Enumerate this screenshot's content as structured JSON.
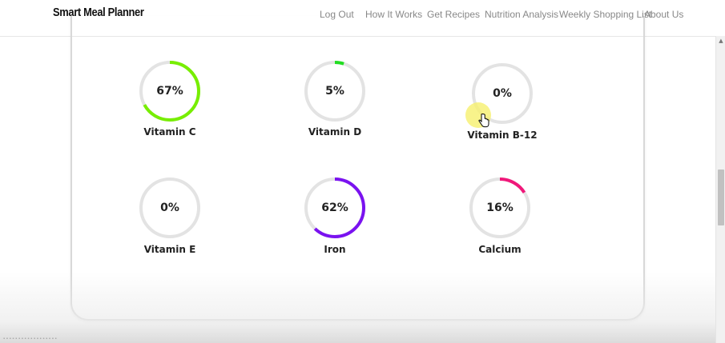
{
  "header": {
    "brand": "Smart Meal Planner",
    "nav": [
      "Log Out",
      "How It Works",
      "Get Recipes",
      "Nutrition Analysis",
      "Weekly Shopping List",
      "About Us"
    ]
  },
  "nutrients": [
    {
      "label": "Vitamin C",
      "value_text": "67%",
      "percent": 67,
      "color": "#77ee00"
    },
    {
      "label": "Vitamin D",
      "value_text": "5%",
      "percent": 5,
      "color": "#22dd22"
    },
    {
      "label": "Vitamin B-12",
      "value_text": "0%",
      "percent": 0,
      "color": "#cccccc"
    },
    {
      "label": "Vitamin E",
      "value_text": "0%",
      "percent": 0,
      "color": "#cccccc"
    },
    {
      "label": "Iron",
      "value_text": "62%",
      "percent": 62,
      "color": "#7a12f0"
    },
    {
      "label": "Calcium",
      "value_text": "16%",
      "percent": 16,
      "color": "#f0187a"
    }
  ],
  "colors": {
    "ring_track": "#e3e3e3"
  }
}
